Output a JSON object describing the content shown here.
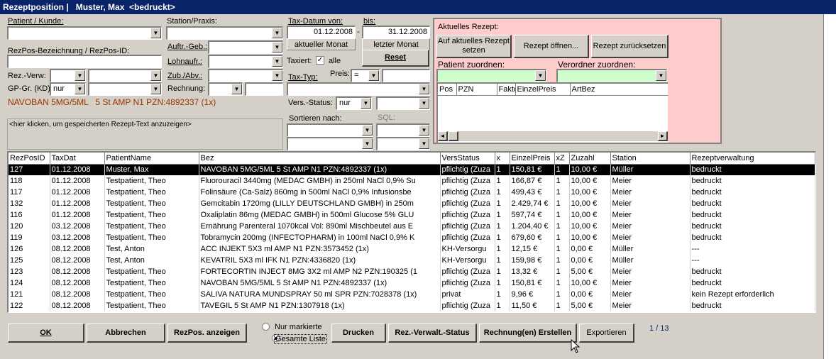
{
  "window": {
    "title": "Rezeptposition |   Muster, Max  <bedruckt>"
  },
  "filters": {
    "patient_label": "Patient / Kunde:",
    "station_label": "Station/Praxis:",
    "tax_from_label": "Tax-Datum von:",
    "tax_from_value": "01.12.2008",
    "tax_to_label": "bis:",
    "tax_to_value": "31.12.2008",
    "dash": "-",
    "current_month": "aktueller Monat",
    "last_month": "letzter Monat",
    "rezpos_label": "RezPos-Bezeichnung / RezPos-ID:",
    "auftr_label": "Auftr.-Geb.:",
    "lohnaufr_label": "Lohnaufr.:",
    "zub_label": "Zub./Abv.:",
    "rechnung_label": "Rechnung:",
    "rezverw_label": "Rez.-Verw:",
    "gpgr_label": "GP-Gr. (KD)",
    "gpgr_value": "nur",
    "taxiert_label": "Taxiert:",
    "taxiert_checkmark": "✓",
    "alle_label": "alle",
    "reset_label": "Reset",
    "taxtyp_label": "Tax-Typ:",
    "preis_label": "Preis:",
    "preis_op": "=",
    "versstatus_label": "Vers.-Status:",
    "versstatus_value": "nur",
    "sort_label": "Sortieren nach:",
    "sql_label": "SQL:",
    "selected_item": "NAVOBAN 5MG/5ML   5 St AMP N1 PZN:4892337 (1x)",
    "rezept_text_hint": "<hier klicken, um gespeicherten Rezept-Text anzuzeigen>"
  },
  "rezept_panel": {
    "title": "Aktuelles Rezept:",
    "btn_set": "Auf aktuelles Rezept setzen",
    "btn_open": "Rezept öffnen...",
    "btn_reset": "Rezept zurücksetzen",
    "patient_assign": "Patient zuordnen:",
    "verordner_assign": "Verordner zuordnen:",
    "columns": [
      "Pos",
      "PZN",
      "Faktor",
      "EinzelPreis",
      "ArtBez"
    ]
  },
  "table": {
    "columns": [
      "RezPosID",
      "TaxDat",
      "PatientName",
      "Bez",
      "VersStatus",
      "x",
      "EinzelPreis",
      "xZ",
      "Zuzahl",
      "Station",
      "Rezeptverwaltung"
    ],
    "rows": [
      [
        "127",
        "01.12.2008",
        "Muster, Max",
        "NAVOBAN 5MG/5ML   5 St AMP N1 PZN:4892337 (1x)",
        "pflichtig (Zuza",
        "1",
        "150,81 €",
        "1",
        "10,00 €",
        "Müller",
        "bedruckt"
      ],
      [
        "118",
        "01.12.2008",
        "Testpatient, Theo",
        "Fluorouracil 3440mg (MEDAC GMBH) in 250ml NaCl 0,9% Su",
        "pflichtig (Zuza",
        "1",
        "166,87 €",
        "1",
        "10,00 €",
        "Meier",
        "bedruckt"
      ],
      [
        "117",
        "01.12.2008",
        "Testpatient, Theo",
        "Folinsäure (Ca-Salz) 860mg in 500ml NaCl 0,9% Infusionsbe",
        "pflichtig (Zuza",
        "1",
        "499,43 €",
        "1",
        "10,00 €",
        "Meier",
        "bedruckt"
      ],
      [
        "132",
        "01.12.2008",
        "Testpatient, Theo",
        "Gemcitabin 1720mg (LILLY DEUTSCHLAND GMBH) in 250m",
        "pflichtig (Zuza",
        "1",
        "2.429,74 €",
        "1",
        "10,00 €",
        "Meier",
        "bedruckt"
      ],
      [
        "116",
        "01.12.2008",
        "Testpatient, Theo",
        "Oxaliplatin 86mg (MEDAC GMBH) in 500ml Glucose 5% GLU",
        "pflichtig (Zuza",
        "1",
        "597,74 €",
        "1",
        "10,00 €",
        "Meier",
        "bedruckt"
      ],
      [
        "120",
        "03.12.2008",
        "Testpatient, Theo",
        "Ernährung Parenteral 1070kcal Vol: 890ml Mischbeutel aus E",
        "pflichtig (Zuza",
        "1",
        "1.204,40 €",
        "1",
        "10,00 €",
        "Meier",
        "bedruckt"
      ],
      [
        "119",
        "03.12.2008",
        "Testpatient, Theo",
        "Tobramycin 200mg (INFECTOPHARM) in 100ml NaCl 0,9% K",
        "pflichtig (Zuza",
        "1",
        "679,60 €",
        "1",
        "10,00 €",
        "Meier",
        "bedruckt"
      ],
      [
        "126",
        "08.12.2008",
        "Test, Anton",
        "ACC INJEKT   5X3 ml AMP N1 PZN:3573452 (1x)",
        "KH-Versorgu",
        "1",
        "12,15 €",
        "1",
        "0,00 €",
        "Müller",
        "---"
      ],
      [
        "125",
        "08.12.2008",
        "Test, Anton",
        "KEVATRIL   5X3 ml IFK N1 PZN:4336820 (1x)",
        "KH-Versorgu",
        "1",
        "159,98 €",
        "1",
        "0,00 €",
        "Müller",
        "---"
      ],
      [
        "123",
        "08.12.2008",
        "Testpatient, Theo",
        "FORTECORTIN INJECT 8MG   3X2 ml AMP N2 PZN:190325 (1",
        "pflichtig (Zuza",
        "1",
        "13,32 €",
        "1",
        "5,00 €",
        "Meier",
        "bedruckt"
      ],
      [
        "124",
        "08.12.2008",
        "Testpatient, Theo",
        "NAVOBAN 5MG/5ML   5 St AMP N1 PZN:4892337 (1x)",
        "pflichtig (Zuza",
        "1",
        "150,81 €",
        "1",
        "10,00 €",
        "Meier",
        "bedruckt"
      ],
      [
        "121",
        "08.12.2008",
        "Testpatient, Theo",
        "SALIVA NATURA MUNDSPRAY   50 ml SPR  PZN:7028378 (1x)",
        "privat",
        "1",
        "9,96 €",
        "1",
        "0,00 €",
        "Meier",
        "kein Rezept erforderlich"
      ],
      [
        "122",
        "08.12.2008",
        "Testpatient, Theo",
        "TAVEGIL   5 St AMP N1 PZN:1307918 (1x)",
        "pflichtig (Zuza",
        "1",
        "11,50 €",
        "1",
        "5,00 €",
        "Meier",
        "bedruckt"
      ]
    ]
  },
  "bottom": {
    "ok": "OK",
    "abbrechen": "Abbrechen",
    "rezpos_anzeigen": "RezPos. anzeigen",
    "nur_markierte": "Nur markierte",
    "gesamte_liste": "Gesamte Liste",
    "drucken": "Drucken",
    "rez_verwalt_status": "Rez.-Verwalt.-Status",
    "rechnung_erstellen": "Rechnung(en) Erstellen",
    "exportieren": "Exportieren",
    "page_info": "1 / 13"
  },
  "colors": {
    "title_bg": "#0a246a",
    "panel_pink": "#ffcccc",
    "field_green": "#ccffcc",
    "selected_item_text": "#993300"
  },
  "icons": {
    "dropdown": "▼",
    "scroll_left": "◄",
    "scroll_right": "►"
  }
}
